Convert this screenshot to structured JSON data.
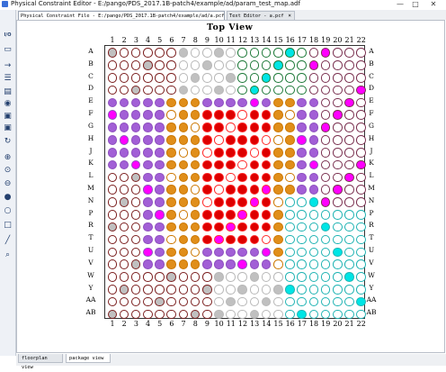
{
  "window": {
    "title": "Physical Constraint Editor - E:/pango/PDS_2017.1B-patch4/example/ad/param_test_map.adf",
    "minimize": "—",
    "maximize": "□",
    "close": "✕"
  },
  "tabs": [
    {
      "label": "Physical Constraint File - E:/pango/PDS_2017.1B-patch4/example/ad/a.pcf",
      "active": true
    },
    {
      "label": "Text Editor - a.pcf",
      "active": false
    }
  ],
  "bottom_tabs": [
    {
      "label": "floorplan view",
      "active": false
    },
    {
      "label": "package view",
      "active": true
    }
  ],
  "toolbar": {
    "icons": [
      "io-icon",
      "window-icon",
      "arrow-icon",
      "list-icon",
      "document-icon",
      "globe-icon",
      "save-icon",
      "save-as-icon",
      "refresh-icon",
      "zoom-in-icon",
      "zoom-fit-icon",
      "zoom-out-icon",
      "circle-icon",
      "circle-outline-icon",
      "rectangle-icon",
      "ruler-icon",
      "search-icon"
    ]
  },
  "view": {
    "title": "Top View",
    "columns": [
      "1",
      "2",
      "3",
      "4",
      "5",
      "6",
      "7",
      "8",
      "9",
      "10",
      "11",
      "12",
      "13",
      "14",
      "15",
      "16",
      "17",
      "18",
      "19",
      "20",
      "21",
      "22"
    ],
    "rows": [
      "A",
      "B",
      "C",
      "D",
      "E",
      "F",
      "G",
      "H",
      "J",
      "K",
      "L",
      "M",
      "N",
      "P",
      "R",
      "T",
      "U",
      "V",
      "W",
      "Y",
      "AA",
      "AB"
    ]
  },
  "legend_colors": {
    "banks": {
      "b1": "#7b1f1f",
      "b2": "#b8b8b8",
      "b3": "#8e4fbf",
      "b4": "#1f7a3a",
      "b5": "#cc7700",
      "b6": "#ff2a2a",
      "b7": "#1fb3b3",
      "b8": "#7a3050"
    },
    "fills": {
      "purple": "#a25fd6",
      "magenta": "#ff00ff",
      "cyan": "#00e5e5",
      "orange": "#e08e1a",
      "red": "#dd0000",
      "gray": "#c0c0c0"
    }
  }
}
